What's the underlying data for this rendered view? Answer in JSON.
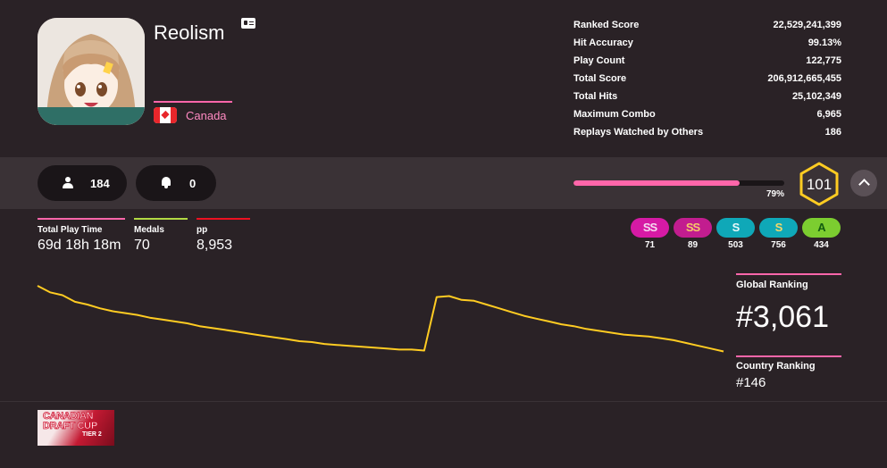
{
  "user": {
    "username": "Reolism",
    "country": "Canada"
  },
  "stats": [
    {
      "label": "Ranked Score",
      "value": "22,529,241,399"
    },
    {
      "label": "Hit Accuracy",
      "value": "99.13%"
    },
    {
      "label": "Play Count",
      "value": "122,775"
    },
    {
      "label": "Total Score",
      "value": "206,912,665,455"
    },
    {
      "label": "Total Hits",
      "value": "25,102,349"
    },
    {
      "label": "Maximum Combo",
      "value": "6,965"
    },
    {
      "label": "Replays Watched by Others",
      "value": "186"
    }
  ],
  "social": {
    "followers": "184",
    "mapping_subscribers": "0"
  },
  "level": {
    "value": "101",
    "progress_pct_label": "79%",
    "progress": 0.79
  },
  "summary": {
    "play_time_label": "Total Play Time",
    "play_time": "69d 18h 18m",
    "medals_label": "Medals",
    "medals": "70",
    "pp_label": "pp",
    "pp": "8,953"
  },
  "grades": [
    {
      "grade": "SS",
      "count": "71",
      "bg": "#d61aa5",
      "fg": "#f5d9f0"
    },
    {
      "grade": "SS",
      "count": "89",
      "bg": "#c21d8f",
      "fg": "#f5c96a"
    },
    {
      "grade": "S",
      "count": "503",
      "bg": "#0fa8b8",
      "fg": "#e8f8fa"
    },
    {
      "grade": "S",
      "count": "756",
      "bg": "#0fa8b8",
      "fg": "#f5d76a"
    },
    {
      "grade": "A",
      "count": "434",
      "bg": "#7ccd30",
      "fg": "#135c10"
    }
  ],
  "ranking": {
    "global_label": "Global Ranking",
    "global": "#3,061",
    "country_label": "Country Ranking",
    "country": "#146"
  },
  "chart_data": {
    "type": "line",
    "color": "#ffcc22",
    "note_values": "relative rank history; lower on screen = worse rank",
    "values": [
      100,
      93,
      90,
      83,
      80,
      76,
      73,
      71,
      69,
      66,
      64,
      62,
      60,
      57,
      55,
      53,
      51,
      49,
      47,
      45,
      43,
      41,
      40,
      38,
      37,
      36,
      35,
      34,
      33,
      32,
      32,
      31,
      88,
      89,
      85,
      84,
      80,
      76,
      72,
      68,
      65,
      62,
      59,
      57,
      54,
      52,
      50,
      48,
      47,
      46,
      44,
      42,
      39,
      36,
      33,
      30
    ]
  },
  "badge": {
    "line1": "CANADIAN",
    "line2": "DRAFT CUP",
    "line3": "TIER 2"
  }
}
